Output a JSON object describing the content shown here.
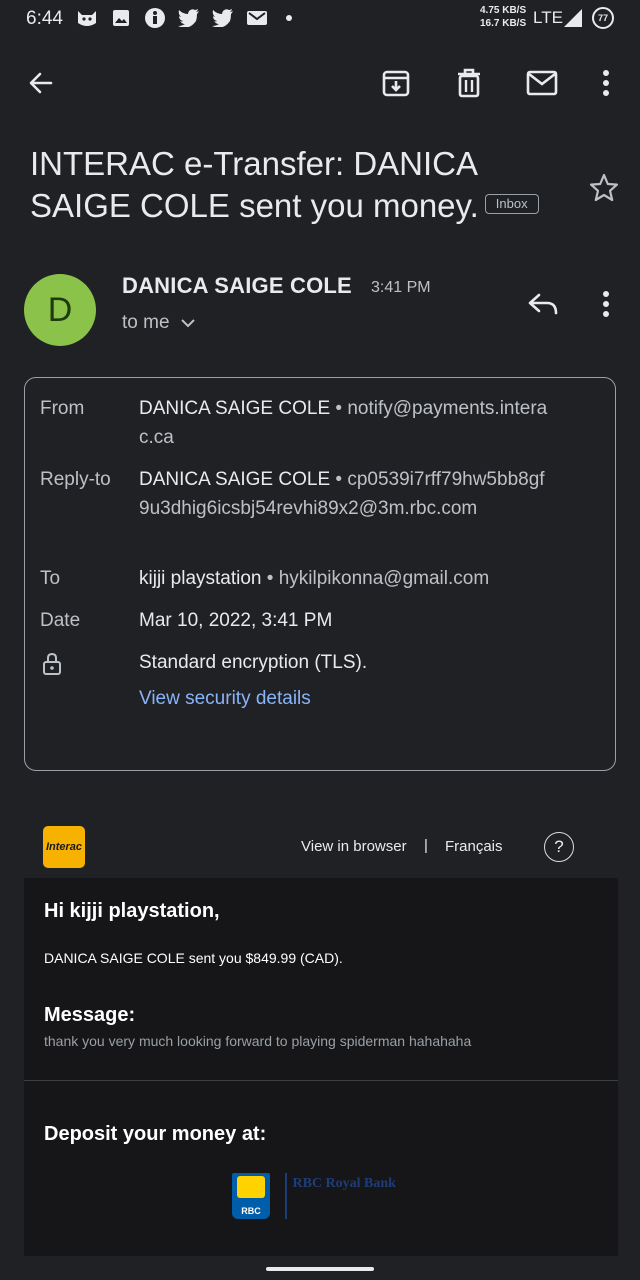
{
  "status_bar": {
    "time": "6:44",
    "net_up": "4.75 KB/S",
    "net_down": "16.7 KB/S",
    "network": "LTE",
    "battery": "77",
    "icons": [
      "cat-icon",
      "image-icon",
      "accessibility-icon",
      "twitter-icon",
      "twitter-icon",
      "sms-icon"
    ]
  },
  "toolbar": {
    "icons": [
      "back-arrow-icon",
      "archive-icon",
      "delete-icon",
      "mail-icon",
      "more-vert-icon"
    ]
  },
  "email": {
    "subject": "INTERAC e-Transfer: DANICA SAIGE COLE sent you money.",
    "label": "Inbox",
    "sender_initial": "D",
    "sender_name": "DANICA SAIGE COLE",
    "time": "3:41 PM",
    "to_me": "to me",
    "avatar_color": "#8bc34a"
  },
  "details": {
    "from_label": "From",
    "from_name": "DANICA SAIGE COLE",
    "from_email": "notify@payments.interac.ca",
    "replyto_label": "Reply-to",
    "replyto_name": "DANICA SAIGE COLE",
    "replyto_email": "cp0539i7rff79hw5bb8gf9u3dhig6icsbj54revhi89x2@3m.rbc.com",
    "to_label": "To",
    "to_name": "kijji playstation",
    "to_email": "hykilpikonna@gmail.com",
    "date_label": "Date",
    "date_value": "Mar 10, 2022, 3:41 PM",
    "encryption": "Standard encryption (TLS).",
    "security_link": "View security details"
  },
  "body": {
    "logo_text": "Interac",
    "view_browser": "View in browser",
    "separator": "|",
    "francais": "Français",
    "help": "?",
    "greeting": "Hi kijji playstation,",
    "sent_line": "DANICA SAIGE COLE sent you $849.99 (CAD).",
    "message_heading": "Message:",
    "message_text": "thank you very much looking forward to playing spiderman hahahaha",
    "deposit_heading": "Deposit your money at:",
    "bank_abbrev": "RBC",
    "bank_name": "RBC Royal Bank"
  },
  "colors": {
    "background": "#202124",
    "link": "#8ab4f8",
    "interac_yellow": "#f7b100",
    "rbc_blue": "#005daa"
  }
}
